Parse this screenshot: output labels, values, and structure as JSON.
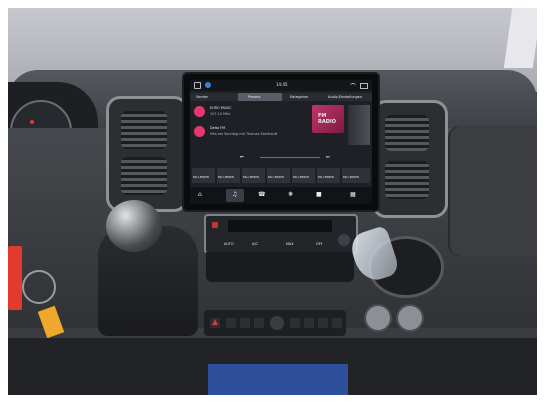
{
  "screen": {
    "clock": "14:45",
    "tabs": [
      "Sender",
      "Presets",
      "Kategorien",
      "Audio-Einstellungen"
    ],
    "active_tab_index": 1,
    "stations": [
      {
        "name": "EURO MUSIC",
        "info": "107.10 MHz"
      },
      {
        "name": "Delta FM",
        "info": "Hits am Sonntag mit Thomas Eberhardt"
      }
    ],
    "logo_text": "FM\nRADIO",
    "presets": [
      "BIG LERNEN",
      "BIG LERNEN",
      "BIG LERNEN",
      "BIG LERNEN",
      "BIG LERNEN",
      "BIG LERNEN",
      "BIG LERNEN"
    ],
    "dock_icons": [
      "home-icon",
      "music-icon",
      "phone-icon",
      "fan-icon",
      "car-icon",
      "apps-grid-icon"
    ],
    "accent_color": "#e5386f"
  },
  "climate": {
    "labels": [
      "AUTO",
      "A/C",
      "MAX",
      "OFF"
    ],
    "indicator_color": "#c0392b"
  },
  "switch_panel": {
    "hazard_color": "#d63a32"
  },
  "colors": {
    "dash": "#3a3c3f",
    "upper_dash": "#4a4d52",
    "windshield": "#b6b8c0",
    "mat": "#2e4f9c",
    "keyfob_tag": "#e23a2c"
  }
}
